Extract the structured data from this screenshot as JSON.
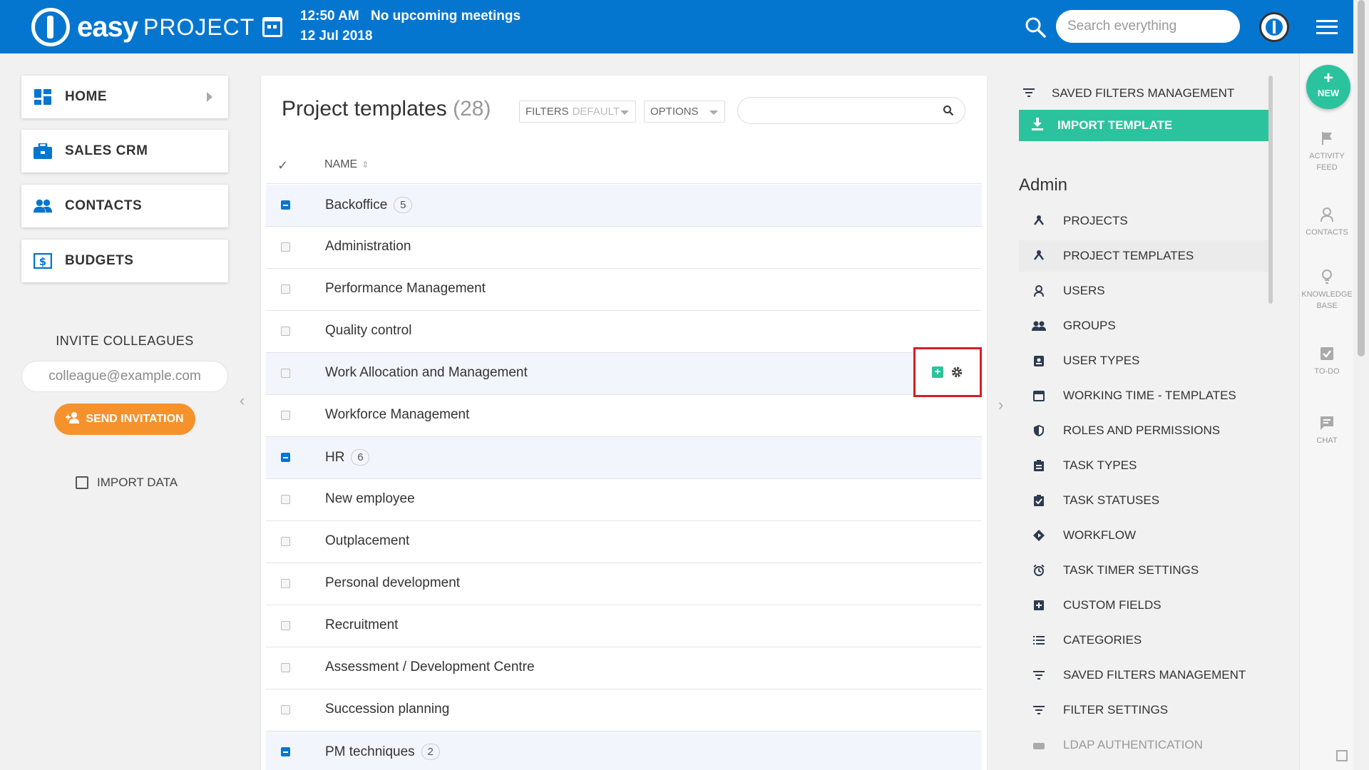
{
  "header": {
    "logo_easy": "easy",
    "logo_project": "PROJECT",
    "time": "12:50 AM",
    "meetings": "No upcoming meetings",
    "date": "12 Jul 2018",
    "search_placeholder": "Search everything"
  },
  "left_nav": {
    "items": [
      {
        "label": "HOME",
        "icon": "dashboard-icon"
      },
      {
        "label": "SALES CRM",
        "icon": "briefcase-icon"
      },
      {
        "label": "CONTACTS",
        "icon": "people-icon"
      },
      {
        "label": "BUDGETS",
        "icon": "money-icon"
      }
    ],
    "invite_title": "INVITE COLLEAGUES",
    "invite_placeholder": "colleague@example.com",
    "send_label": "SEND INVITATION",
    "import_label": "IMPORT DATA"
  },
  "main": {
    "title": "Project templates",
    "count": "(28)",
    "filters_label": "FILTERS",
    "filters_value": "DEFAULT",
    "options_label": "OPTIONS",
    "column_name": "NAME",
    "rows": [
      {
        "name": "Backoffice",
        "group": true,
        "badge": "5"
      },
      {
        "name": "Administration"
      },
      {
        "name": "Performance Management"
      },
      {
        "name": "Quality control"
      },
      {
        "name": "Work Allocation and Management",
        "hover": true
      },
      {
        "name": "Workforce Management"
      },
      {
        "name": "HR",
        "group": true,
        "badge": "6"
      },
      {
        "name": "New employee"
      },
      {
        "name": "Outplacement"
      },
      {
        "name": "Personal development"
      },
      {
        "name": "Recruitment"
      },
      {
        "name": "Assessment / Development Centre"
      },
      {
        "name": "Succession planning"
      },
      {
        "name": "PM techniques",
        "group": true,
        "badge": "2"
      }
    ]
  },
  "admin": {
    "saved_filters": "SAVED FILTERS MANAGEMENT",
    "import_template": "IMPORT TEMPLATE",
    "heading": "Admin",
    "items": [
      {
        "label": "PROJECTS",
        "icon": "sitemap-icon"
      },
      {
        "label": "PROJECT TEMPLATES",
        "icon": "sitemap-icon",
        "active": true
      },
      {
        "label": "USERS",
        "icon": "user-icon"
      },
      {
        "label": "GROUPS",
        "icon": "group-icon"
      },
      {
        "label": "USER TYPES",
        "icon": "id-badge-icon"
      },
      {
        "label": "WORKING TIME - TEMPLATES",
        "icon": "calendar-icon"
      },
      {
        "label": "ROLES AND PERMISSIONS",
        "icon": "shield-icon"
      },
      {
        "label": "TASK TYPES",
        "icon": "clipboard-icon"
      },
      {
        "label": "TASK STATUSES",
        "icon": "clipboard-check-icon"
      },
      {
        "label": "WORKFLOW",
        "icon": "diamond-arrow-icon"
      },
      {
        "label": "TASK TIMER SETTINGS",
        "icon": "alarm-icon"
      },
      {
        "label": "CUSTOM FIELDS",
        "icon": "plus-square-icon"
      },
      {
        "label": "CATEGORIES",
        "icon": "list-icon"
      },
      {
        "label": "SAVED FILTERS MANAGEMENT",
        "icon": "filter-icon"
      },
      {
        "label": "FILTER SETTINGS",
        "icon": "filter-icon"
      },
      {
        "label": "LDAP AUTHENTICATION",
        "icon": "server-icon",
        "fade": true
      }
    ]
  },
  "right_rail": {
    "new_label": "NEW",
    "items": [
      {
        "label": "ACTIVITY FEED",
        "icon": "flag-icon"
      },
      {
        "label": "CONTACTS",
        "icon": "person-icon"
      },
      {
        "label": "KNOWLEDGE BASE",
        "icon": "lightbulb-icon"
      },
      {
        "label": "TO-DO",
        "icon": "checkbox-icon"
      },
      {
        "label": "CHAT",
        "icon": "chat-icon"
      }
    ]
  },
  "colors": {
    "brand_blue": "#0576d0",
    "accent_green": "#2bc39d",
    "invite_orange": "#f6922b",
    "highlight_red": "#d31f28"
  }
}
